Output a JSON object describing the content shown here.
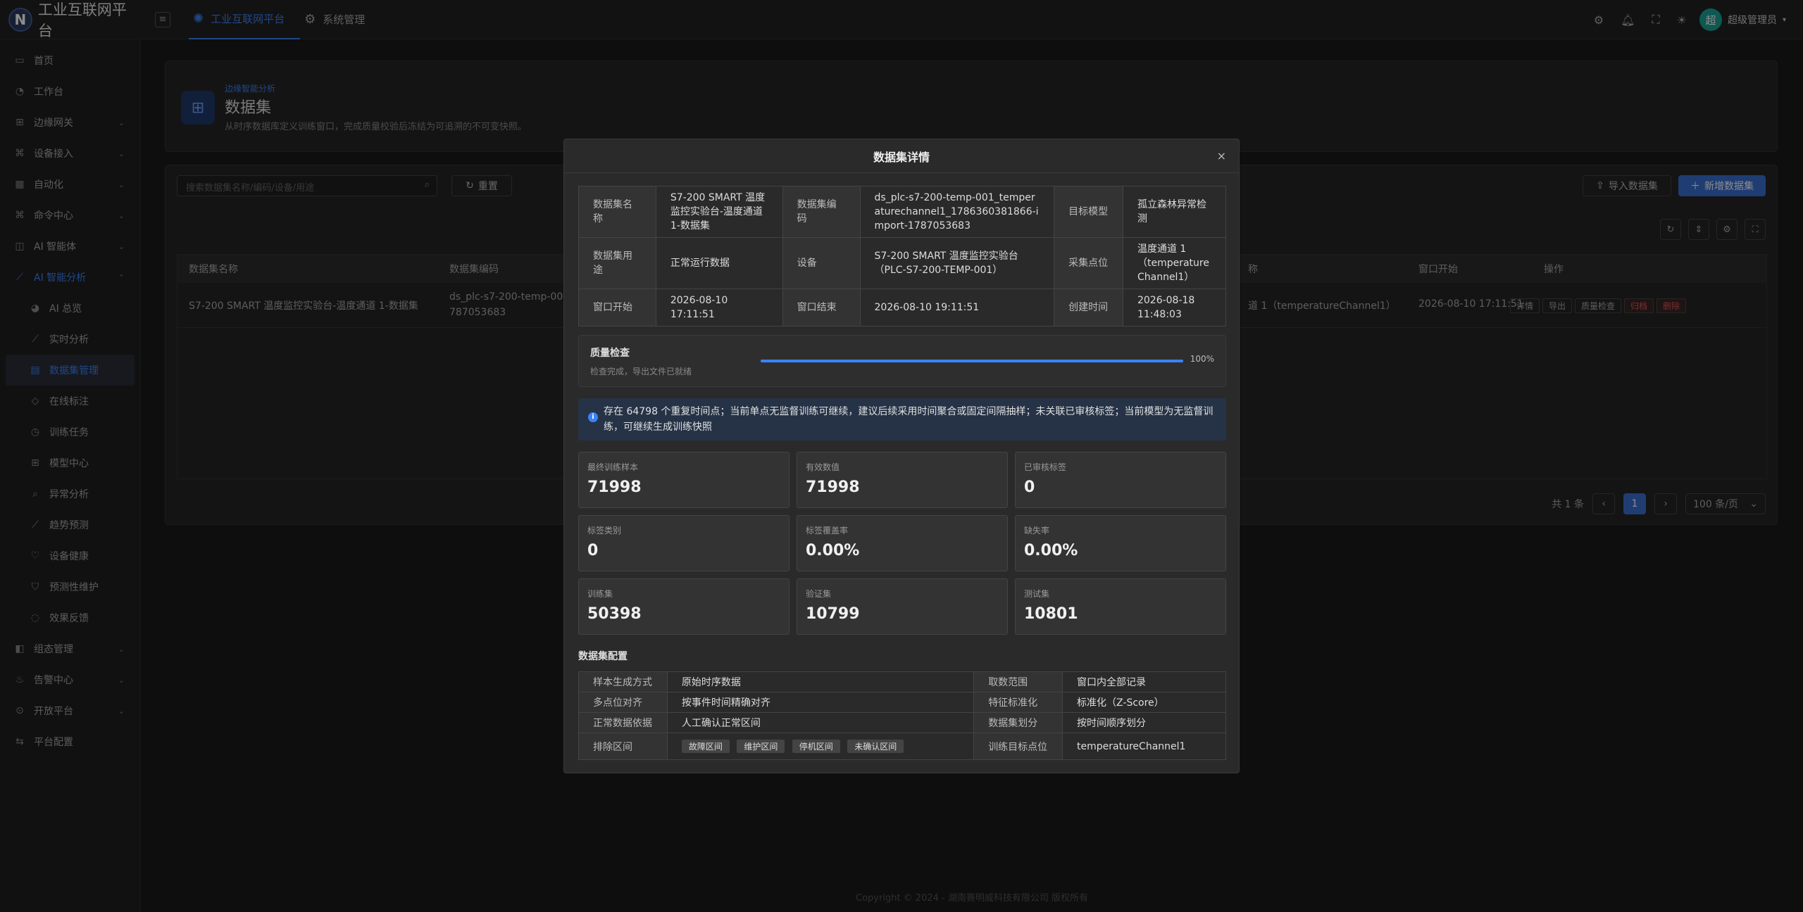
{
  "app": {
    "logo_letter": "N",
    "title": "工业互联网平台"
  },
  "top_tabs": [
    {
      "label": "工业互联网平台",
      "active": true
    },
    {
      "label": "系统管理",
      "active": false
    }
  ],
  "user": {
    "avatar": "超",
    "name": "超级管理员"
  },
  "sidebar": {
    "items": [
      {
        "label": "首页"
      },
      {
        "label": "工作台"
      },
      {
        "label": "边缘网关"
      },
      {
        "label": "设备接入"
      },
      {
        "label": "自动化"
      },
      {
        "label": "命令中心"
      },
      {
        "label": "AI 智能体"
      },
      {
        "label": "AI 智能分析"
      },
      {
        "label": "AI 总览"
      },
      {
        "label": "实时分析"
      },
      {
        "label": "数据集管理"
      },
      {
        "label": "在线标注"
      },
      {
        "label": "训练任务"
      },
      {
        "label": "模型中心"
      },
      {
        "label": "异常分析"
      },
      {
        "label": "趋势预测"
      },
      {
        "label": "设备健康"
      },
      {
        "label": "预测性维护"
      },
      {
        "label": "效果反馈"
      },
      {
        "label": "组态管理"
      },
      {
        "label": "告警中心"
      },
      {
        "label": "开放平台"
      },
      {
        "label": "平台配置"
      }
    ]
  },
  "page": {
    "crumb": "边缘智能分析",
    "title": "数据集",
    "desc": "从时序数据库定义训练窗口，完成质量校验后冻结为可追溯的不可变快照。"
  },
  "toolbar": {
    "search_placeholder": "搜索数据集名称/编码/设备/用途",
    "reset_label": "重置",
    "import_label": "导入数据集",
    "add_label": "新增数据集"
  },
  "table": {
    "headers": [
      "数据集名称",
      "数据集编码",
      "称",
      "窗口开始",
      "操作"
    ],
    "row": {
      "name": "S7-200 SMART 温度监控实验台-温度通道 1-数据集",
      "code_line1": "ds_plc-s7-200-temp-001",
      "code_line2": "787053683",
      "point": "道 1（temperatureChannel1）",
      "window_start": "2026-08-10 17:11:51",
      "actions": [
        "详情",
        "导出",
        "质量检查",
        "归档",
        "删除"
      ]
    }
  },
  "pager": {
    "total": "共 1 条",
    "page": "1",
    "size": "100 条/页"
  },
  "footer": "Copyright © 2024 - 湖南赛明威科技有限公司 版权所有",
  "modal": {
    "title": "数据集详情",
    "info": {
      "name_label": "数据集名称",
      "name_value": "S7-200 SMART 温度监控实验台-温度通道1-数据集",
      "code_label": "数据集编码",
      "code_value": "ds_plc-s7-200-temp-001_temperaturechannel1_1786360381866-import-1787053683",
      "model_label": "目标模型",
      "model_value": "孤立森林异常检测",
      "purpose_label": "数据集用途",
      "purpose_value": "正常运行数据",
      "device_label": "设备",
      "device_value": "S7-200 SMART 温度监控实验台（PLC-S7-200-TEMP-001）",
      "point_label": "采集点位",
      "point_value": "温度通道 1（temperature Channel1）",
      "start_label": "窗口开始",
      "start_value": "2026-08-10 17:11:51",
      "end_label": "窗口结束",
      "end_value": "2026-08-10 19:11:51",
      "created_label": "创建时间",
      "created_value": "2026-08-18 11:48:03"
    },
    "quality": {
      "title": "质量检查",
      "sub": "检查完成，导出文件已就绪",
      "pct_label": "100%",
      "progress": 1.0
    },
    "alert": "存在 64798 个重复时间点；当前单点无监督训练可继续，建议后续采用时间聚合或固定间隔抽样；未关联已审核标签；当前模型为无监督训练，可继续生成训练快照",
    "stats": [
      {
        "label": "最终训练样本",
        "value": "71998"
      },
      {
        "label": "有效数值",
        "value": "71998"
      },
      {
        "label": "已审核标签",
        "value": "0"
      },
      {
        "label": "标签类别",
        "value": "0"
      },
      {
        "label": "标签覆盖率",
        "value": "0.00%"
      },
      {
        "label": "缺失率",
        "value": "0.00%"
      },
      {
        "label": "训练集",
        "value": "50398"
      },
      {
        "label": "验证集",
        "value": "10799"
      },
      {
        "label": "测试集",
        "value": "10801"
      }
    ],
    "config_title": "数据集配置",
    "config": {
      "gen_label": "样本生成方式",
      "gen_value": "原始时序数据",
      "range_label": "取数范围",
      "range_value": "窗口内全部记录",
      "align_label": "多点位对齐",
      "align_value": "按事件时间精确对齐",
      "norm_label": "特征标准化",
      "norm_value": "标准化（Z-Score）",
      "basis_label": "正常数据依据",
      "basis_value": "人工确认正常区间",
      "split_label": "数据集划分",
      "split_value": "按时间顺序划分",
      "exclude_label": "排除区间",
      "exclude_tags": [
        "故障区间",
        "维护区间",
        "停机区间",
        "未确认区间"
      ],
      "target_label": "训练目标点位",
      "target_value": "temperatureChannel1"
    }
  },
  "colors": {
    "accent": "#3b82f6",
    "danger": "#e05555"
  }
}
